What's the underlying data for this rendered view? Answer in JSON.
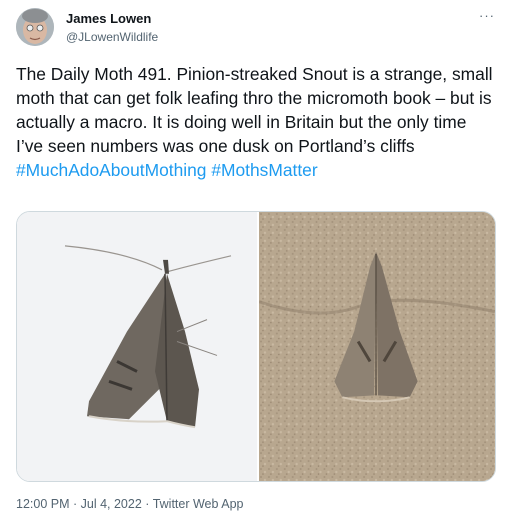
{
  "author": {
    "name": "James Lowen",
    "handle": "@JLowenWildlife"
  },
  "menu": {
    "more_icon": "more-horizontal-icon",
    "more_label": "···"
  },
  "tweet": {
    "text": "The Daily Moth 491. Pinion-streaked Snout is a strange, small moth that can get folk leafing thro the micromoth book – but is actually a macro. It is doing well in Britain but the only time I’ve seen numbers was one dusk on Portland’s cliffs",
    "hashtags": [
      "#MuchAdoAboutMothing",
      "#MothsMatter"
    ]
  },
  "media": {
    "count": 2
  },
  "meta": {
    "time": "12:00 PM",
    "separator": " · ",
    "date": "Jul 4, 2022",
    "source": "Twitter Web App"
  },
  "colors": {
    "link": "#1d9bf0",
    "text": "#0f1419",
    "secondary": "#536471",
    "border": "#cfd9de"
  }
}
